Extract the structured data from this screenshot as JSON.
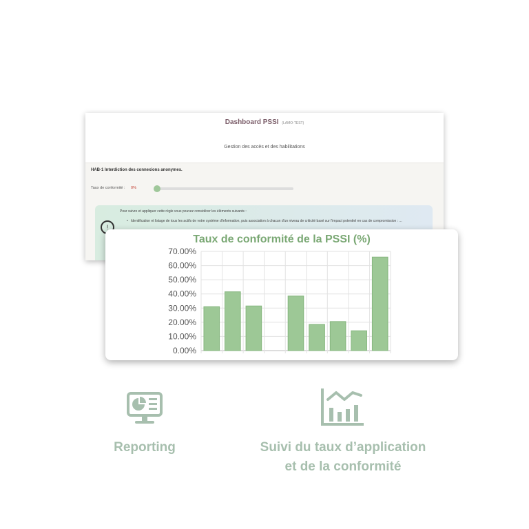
{
  "dashboard": {
    "title": "Dashboard PSSI",
    "title_tag": "(LAMO-TEST)",
    "section_title": "Gestion des accès et des habilitations",
    "rule_title": "HAB-1 Interdiction des connexions anonymes.",
    "taux_label": "Taux de conformité :",
    "taux_value": "0%",
    "slider_level": 0,
    "info_intro": "Pour suivre et appliquer cette règle vous pouvez considérer les éléments suivants :",
    "info_item": "Identification et listage de tous les actifs de votre système d'information, puis association à chacun d'un niveau de criticité basé sur l'impact potentiel en cas de compromission : ..."
  },
  "chart_data": {
    "type": "bar",
    "title": "Taux de conformité de la PSSI (%)",
    "categories": [
      "",
      "",
      "",
      "",
      "",
      "",
      "",
      "",
      ""
    ],
    "values": [
      31,
      41.5,
      31.5,
      0,
      38.5,
      18.5,
      20.5,
      14,
      66
    ],
    "ylim": [
      0,
      70
    ],
    "yticks": [
      0,
      10,
      20,
      30,
      40,
      50,
      60,
      70
    ],
    "ytick_labels": [
      "0.00%",
      "10.00%",
      "20.00%",
      "30.00%",
      "40.00%",
      "50.00%",
      "60.00%",
      "70.00%"
    ],
    "grid": true,
    "bar_color": "#9dc896",
    "bar_border": "#86b67f"
  },
  "features": [
    {
      "icon": "reporting-monitor-icon",
      "label_line1": "Reporting",
      "label_line2": ""
    },
    {
      "icon": "bar-chart-trend-icon",
      "label_line1": "Suivi du taux d’application",
      "label_line2": "et de la conformité"
    }
  ],
  "colors": {
    "accent": "#a7bfae",
    "chart_title": "#7aa874"
  }
}
